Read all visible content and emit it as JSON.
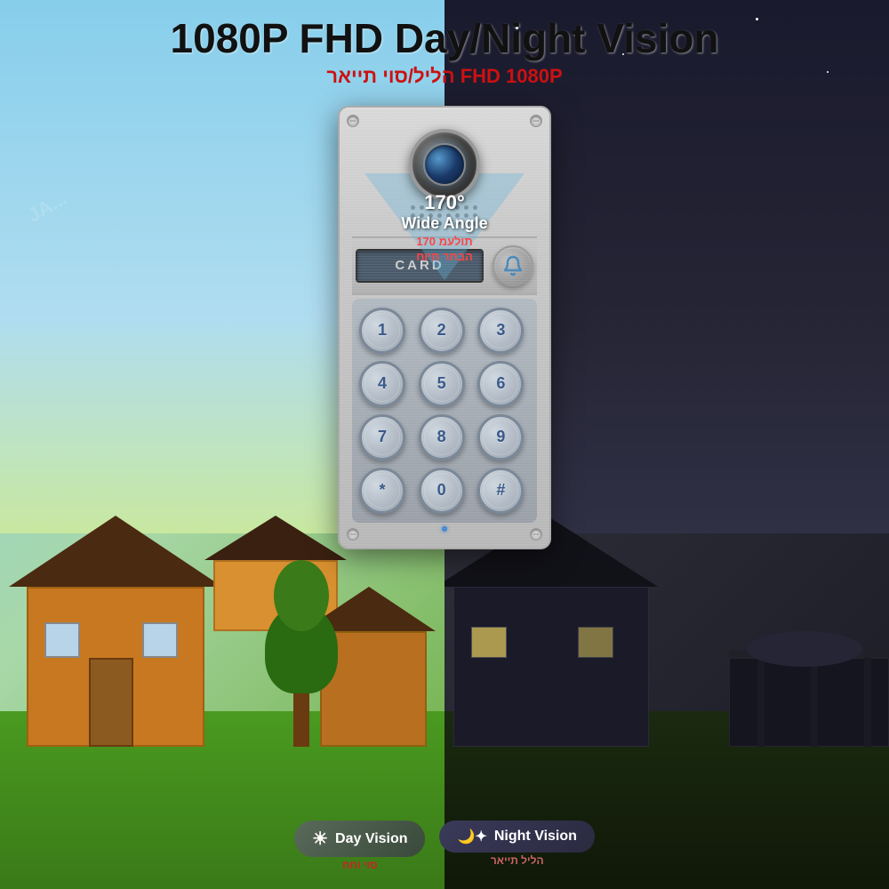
{
  "header": {
    "title_main": "1080P FHD Day/Night Vision",
    "title_hebrew": "הליל/סוי תייאר FHD 1080P"
  },
  "camera": {
    "wide_angle_deg": "170°",
    "wide_angle_label": "Wide Angle",
    "wide_angle_hebrew_line1": "תולעמ 170",
    "wide_angle_hebrew_line2": "הבחר תיוח"
  },
  "card_reader": {
    "label": "CARD"
  },
  "keypad": {
    "keys": [
      "1",
      "2",
      "3",
      "4",
      "5",
      "6",
      "7",
      "8",
      "9",
      "*",
      "0",
      "#"
    ]
  },
  "badges": {
    "day": {
      "label": "Day Vision",
      "hebrew": "סוי וחח",
      "icon": "sun"
    },
    "night": {
      "label": "Night Vision",
      "hebrew": "הליל תייאר",
      "icon": "moon"
    }
  }
}
